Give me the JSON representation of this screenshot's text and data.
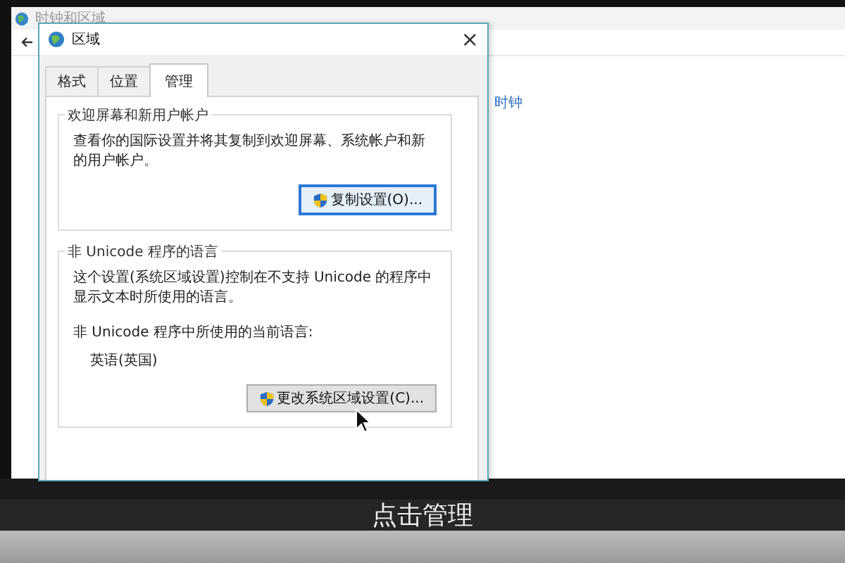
{
  "background_window": {
    "title": "时钟和区域",
    "link": "时钟"
  },
  "dialog": {
    "title": "区域",
    "close": "×",
    "tabs": [
      {
        "label": "格式",
        "selected": false
      },
      {
        "label": "位置",
        "selected": false
      },
      {
        "label": "管理",
        "selected": true
      }
    ],
    "groups": [
      {
        "legend": "欢迎屏幕和新用户帐户",
        "lines": [
          {
            "kind": "text",
            "text": "查看你的国际设置并将其复制到欢迎屏幕、系统帐户和新的用户帐户。"
          }
        ],
        "button": "复制设置(O)...",
        "focused": true
      },
      {
        "legend": "非 Unicode 程序的语言",
        "lines": [
          {
            "kind": "text",
            "text": "这个设置(系统区域设置)控制在不支持 Unicode 的程序中显示文本时所使用的语言。"
          },
          {
            "kind": "label",
            "text": "非 Unicode 程序中所使用的当前语言:"
          },
          {
            "kind": "value",
            "text": "英语(英国)"
          }
        ],
        "button": "更改系统区域设置(C)...",
        "focused": false
      }
    ]
  },
  "caption": "点击管理"
}
